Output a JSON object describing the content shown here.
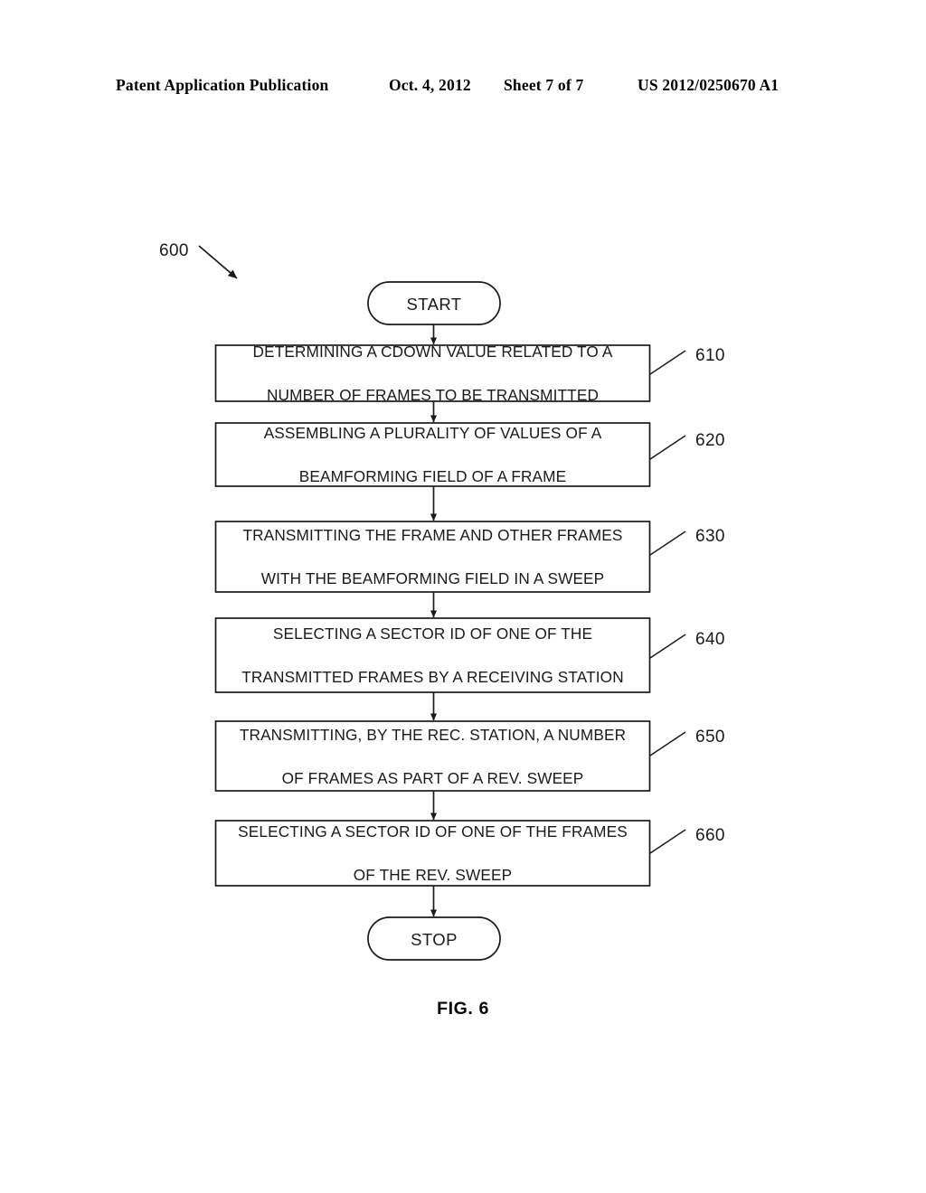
{
  "header": {
    "publication": "Patent Application Publication",
    "date": "Oct. 4, 2012",
    "sheet": "Sheet 7 of 7",
    "patent_number": "US 2012/0250670 A1"
  },
  "figure": {
    "caption": "FIG. 6",
    "diagram_id": "600",
    "start_label": "START",
    "stop_label": "STOP",
    "steps": [
      {
        "ref": "610",
        "line1": "DETERMINING A CDOWN VALUE RELATED TO A",
        "line2": "NUMBER OF FRAMES TO BE TRANSMITTED"
      },
      {
        "ref": "620",
        "line1": "ASSEMBLING A PLURALITY OF VALUES OF A",
        "line2": "BEAMFORMING FIELD OF A FRAME"
      },
      {
        "ref": "630",
        "line1": "TRANSMITTING THE FRAME AND OTHER FRAMES",
        "line2": "WITH THE BEAMFORMING FIELD IN A SWEEP"
      },
      {
        "ref": "640",
        "line1": "SELECTING A SECTOR ID OF ONE OF THE",
        "line2": "TRANSMITTED FRAMES BY A RECEIVING STATION"
      },
      {
        "ref": "650",
        "line1": "TRANSMITTING, BY THE REC. STATION, A NUMBER",
        "line2": "OF FRAMES AS PART OF A REV. SWEEP"
      },
      {
        "ref": "660",
        "line1": "SELECTING A SECTOR ID OF ONE OF THE FRAMES",
        "line2": "OF THE REV. SWEEP"
      }
    ],
    "colors": {
      "stroke": "#1a1a1a",
      "background": "#ffffff"
    }
  }
}
